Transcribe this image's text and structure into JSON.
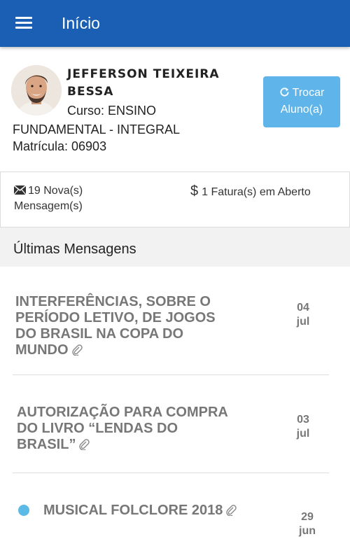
{
  "header": {
    "title": "Início"
  },
  "student": {
    "name": "JEFFERSON TEIXEIRA BESSA",
    "course": "Curso: ENSINO FUNDAMENTAL - INTEGRAL",
    "registration": "Matrícula: 06903",
    "switch_button": "Trocar Aluno(a)"
  },
  "stats": {
    "messages": "19 Nova(s) Mensagem(s)",
    "invoices": "1 Fatura(s) em Aberto",
    "messages_icon": "envelope-icon",
    "invoices_icon": "dollar-icon"
  },
  "section": {
    "title": "Últimas Mensagens"
  },
  "messages": [
    {
      "title": "INTERFERÊNCIAS, SOBRE O PERÍODO LETIVO, DE JOGOS DO BRASIL NA COPA DO MUNDO",
      "day": "04",
      "month": "jul",
      "attachment": true,
      "unread": false
    },
    {
      "title": "AUTORIZAÇÃO PARA COMPRA DO LIVRO “LENDAS DO BRASIL”",
      "day": "03",
      "month": "jul",
      "attachment": true,
      "unread": false
    },
    {
      "title": "MUSICAL FOLCLORE 2018",
      "day": "29",
      "month": "jun",
      "attachment": true,
      "unread": true
    }
  ],
  "colors": {
    "primary": "#1a5fb4",
    "button": "#5fb4ea",
    "unread_dot": "#5bbae6"
  }
}
